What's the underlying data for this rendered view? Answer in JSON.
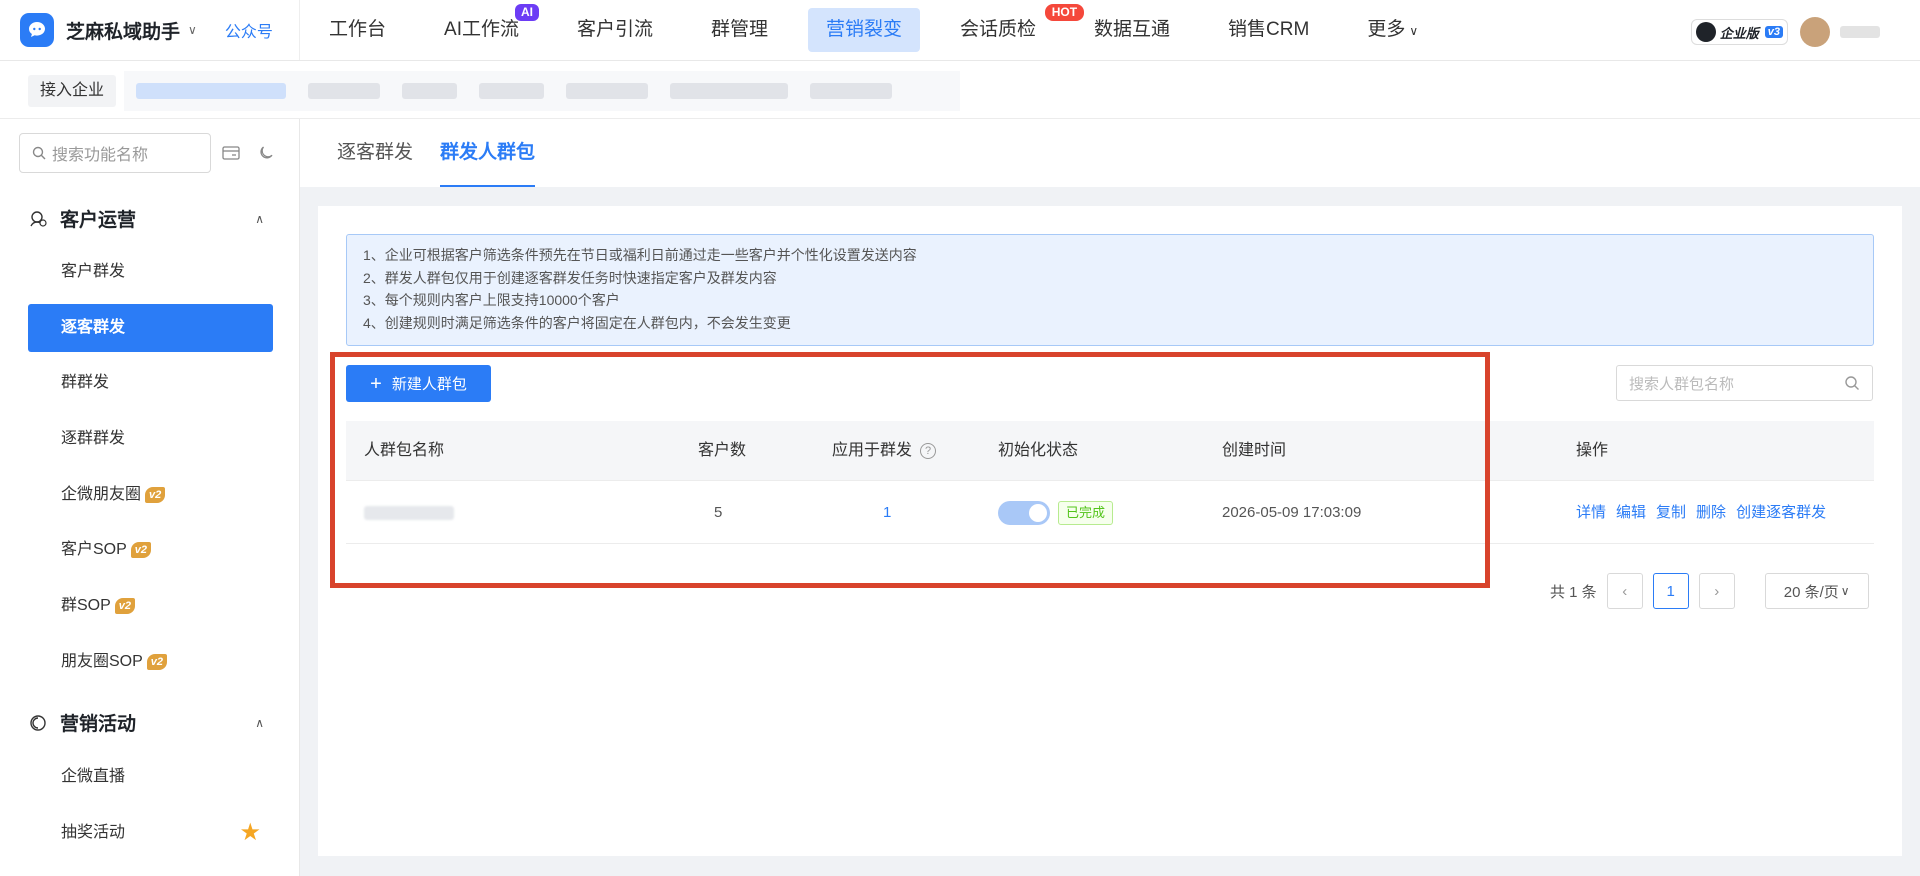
{
  "topbar": {
    "brand": "芝麻私域助手",
    "official_account": "公众号",
    "nav": [
      {
        "label": "工作台"
      },
      {
        "label": "AI工作流",
        "badge": "AI"
      },
      {
        "label": "客户引流"
      },
      {
        "label": "群管理"
      },
      {
        "label": "营销裂变",
        "active": true
      },
      {
        "label": "会话质检",
        "badge": "HOT"
      },
      {
        "label": "数据互通"
      },
      {
        "label": "销售CRM"
      },
      {
        "label": "更多"
      }
    ],
    "edition": "企业版",
    "edition_version": "v3"
  },
  "corpbar": {
    "connect_label": "接入企业"
  },
  "sidebar": {
    "search_placeholder": "搜索功能名称",
    "groups": [
      {
        "title": "客户运营",
        "items": [
          {
            "label": "客户群发"
          },
          {
            "label": "逐客群发",
            "active": true
          },
          {
            "label": "群群发"
          },
          {
            "label": "逐群群发"
          },
          {
            "label": "企微朋友圈",
            "badge": "v2"
          },
          {
            "label": "客户SOP",
            "badge": "v2"
          },
          {
            "label": "群SOP",
            "badge": "v2"
          },
          {
            "label": "朋友圈SOP",
            "badge": "v2"
          }
        ]
      },
      {
        "title": "营销活动",
        "items": [
          {
            "label": "企微直播"
          },
          {
            "label": "抽奖活动",
            "starred": true
          }
        ]
      }
    ]
  },
  "tabs": [
    {
      "label": "逐客群发"
    },
    {
      "label": "群发人群包",
      "active": true
    }
  ],
  "notice": [
    "1、企业可根据客户筛选条件预先在节日或福利日前通过走一些客户并个性化设置发送内容",
    "2、群发人群包仅用于创建逐客群发任务时快速指定客户及群发内容",
    "3、每个规则内客户上限支持10000个客户",
    "4、创建规则时满足筛选条件的客户将固定在人群包内，不会发生变更"
  ],
  "toolbar": {
    "new_button": "新建人群包",
    "search_placeholder": "搜索人群包名称"
  },
  "table": {
    "headers": {
      "name": "人群包名称",
      "customers": "客户数",
      "applied": "应用于群发",
      "init_status": "初始化状态",
      "created": "创建时间",
      "actions": "操作"
    },
    "rows": [
      {
        "customers": "5",
        "applied": "1",
        "status_on": true,
        "status_tag": "已完成",
        "created": "2026-05-09 17:03:09",
        "actions": [
          "详情",
          "编辑",
          "复制",
          "删除",
          "创建逐客群发"
        ]
      }
    ]
  },
  "pagination": {
    "total": "共 1 条",
    "current_page": "1",
    "page_size": "20 条/页"
  },
  "colors": {
    "accent": "#2b7cf6",
    "highlight_border": "#d8432c",
    "hot_badge": "#f5483b",
    "ai_badge": "#6c3cf5",
    "v2_badge": "#e0a13c",
    "success": "#52c41a"
  }
}
